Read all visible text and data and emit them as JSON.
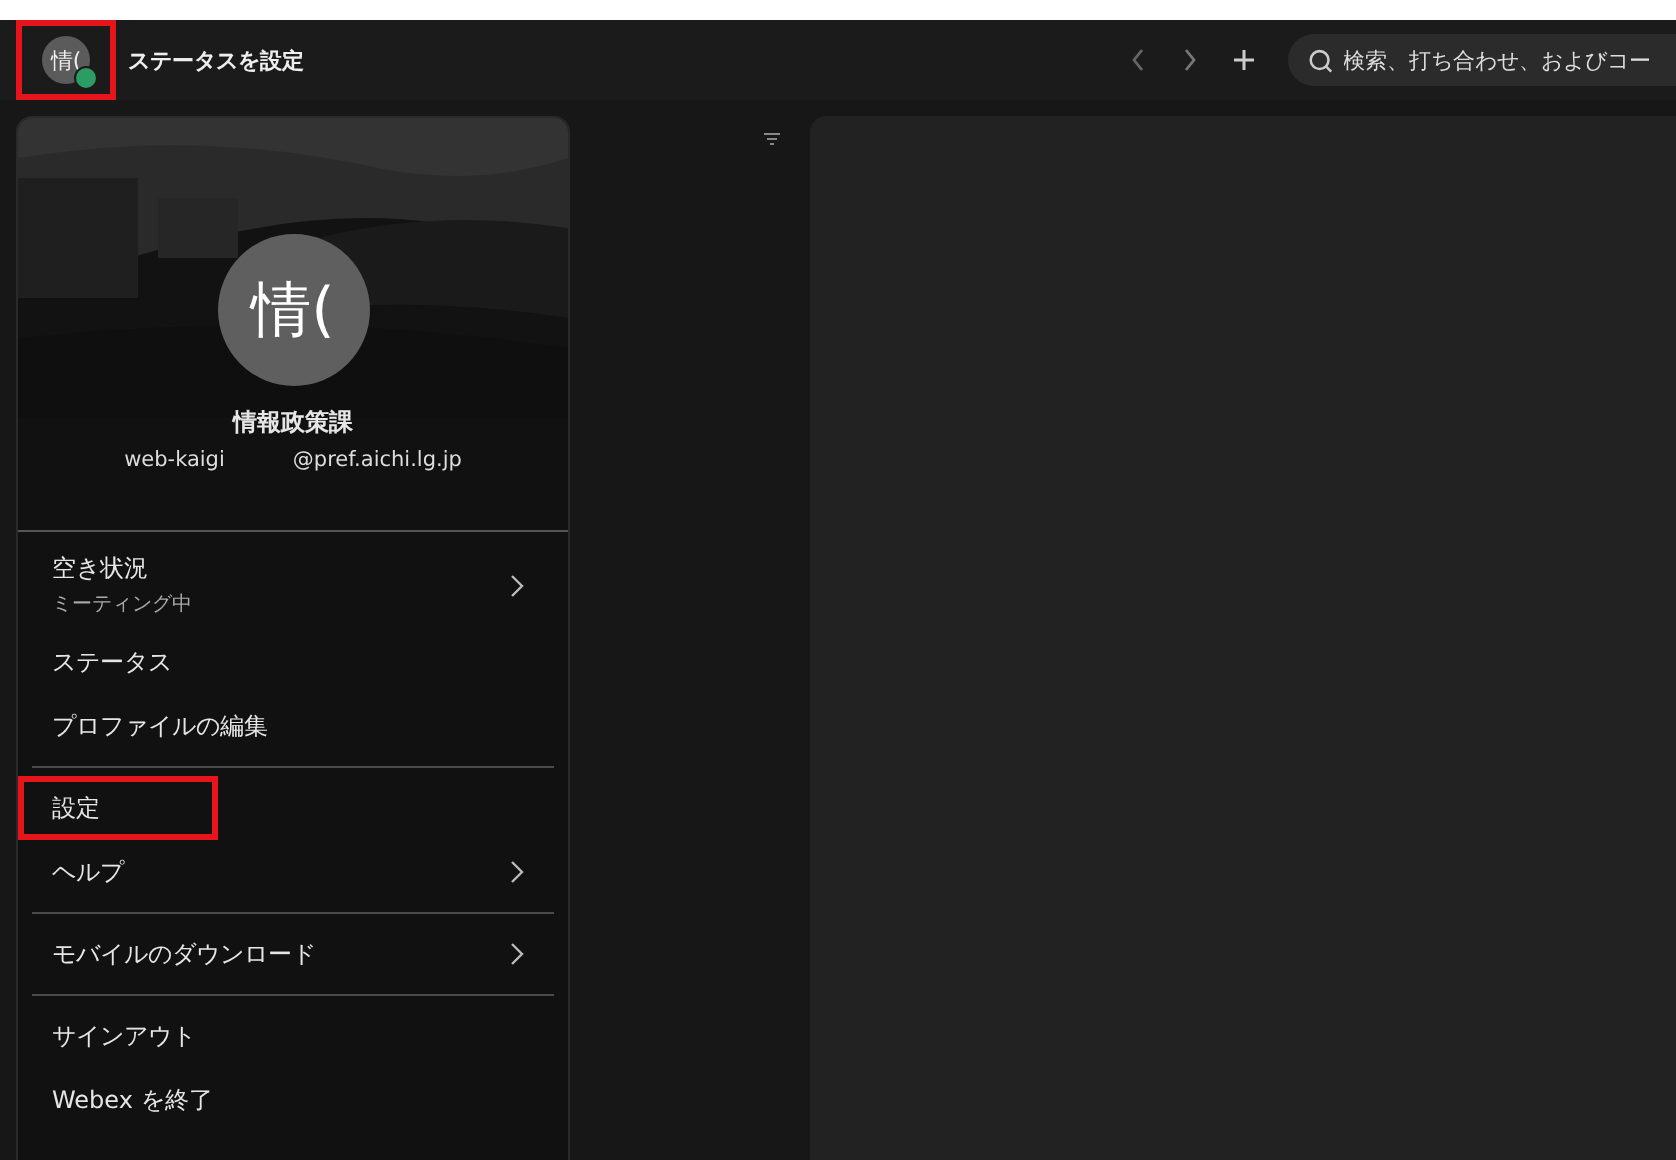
{
  "title_bar": {
    "avatar": {
      "initials": "情(",
      "status_dot": {
        "color": "#2b9c64"
      },
      "highlighted": true
    },
    "status_prompt": "ステータスを設定",
    "search": {
      "placeholder": "検索、打ち合わせ、およびコー"
    }
  },
  "profile_menu": {
    "avatar_initials": "情(",
    "name": "情報政策課",
    "email_user": "web-kaigi",
    "email_domain": "@pref.aichi.lg.jp",
    "groups": [
      {
        "items": [
          {
            "label": "空き状況",
            "sublabel": "ミーティング中",
            "submenu": true,
            "highlighted": false
          },
          {
            "label": "ステータス",
            "submenu": false,
            "highlighted": false
          },
          {
            "label": "プロファイルの編集",
            "submenu": false,
            "highlighted": false
          }
        ]
      },
      {
        "items": [
          {
            "label": "設定",
            "submenu": false,
            "highlighted": true
          },
          {
            "label": "ヘルプ",
            "submenu": true,
            "highlighted": false
          }
        ]
      },
      {
        "items": [
          {
            "label": "モバイルのダウンロード",
            "submenu": true,
            "highlighted": false
          }
        ]
      },
      {
        "items": [
          {
            "label": "サインアウト",
            "submenu": false,
            "highlighted": false
          },
          {
            "label": "Webex を終了",
            "submenu": false,
            "highlighted": false
          }
        ]
      }
    ]
  }
}
